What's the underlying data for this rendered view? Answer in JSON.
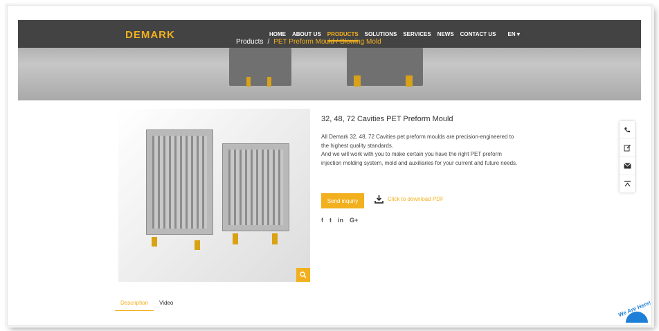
{
  "brand": {
    "logo": "DEMARK"
  },
  "nav": {
    "items": [
      "HOME",
      "ABOUT US",
      "PRODUCTS",
      "SOLUTIONS",
      "SERVICES",
      "NEWS",
      "CONTACT US"
    ],
    "active": "PRODUCTS",
    "lang": "EN"
  },
  "breadcrumb": {
    "root": "Products",
    "separator": "/",
    "current": "PET Preform Mould / Blowing Mold"
  },
  "product": {
    "title": "32, 48, 72 Cavities PET Preform Mould",
    "description_1": "All Demark 32, 48, 72 Cavities pet preform moulds are precision-engineered to the highest quality standards.",
    "description_2": "And we will work with you to make certain you have the right PET preform injection molding system, mold and auxiliaries for your current and future needs.",
    "inquiry_label": "Send inquiry",
    "pdf_label": "Click to download PDF"
  },
  "social": {
    "facebook": "f",
    "twitter": "t",
    "linkedin": "in",
    "google": "G+"
  },
  "tabs": {
    "description": "Description",
    "video": "Video"
  },
  "badge": {
    "text": "We Are Here!"
  },
  "colors": {
    "accent": "#f2b01e",
    "topbar": "#434343"
  },
  "icons": [
    "search-icon",
    "download-icon",
    "phone-icon",
    "edit-icon",
    "mail-icon",
    "to-top-icon",
    "facebook-icon",
    "twitter-icon",
    "linkedin-icon",
    "google-plus-icon"
  ]
}
